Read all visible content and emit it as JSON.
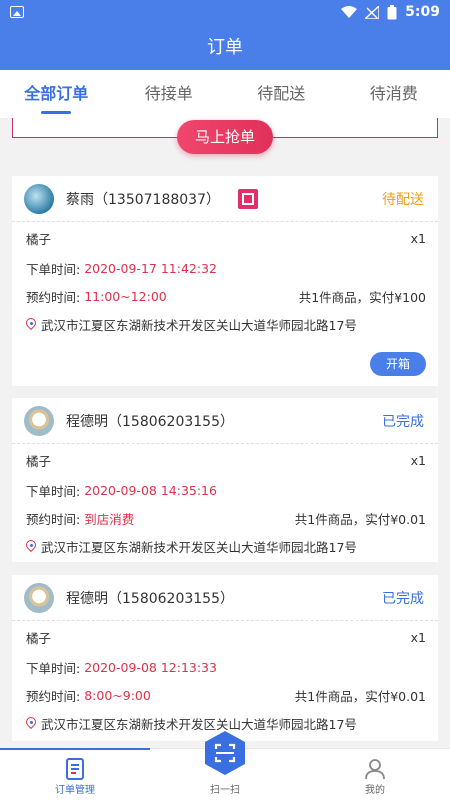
{
  "status_bar": {
    "time": "5:09"
  },
  "header": {
    "title": "订单"
  },
  "tabs": [
    {
      "label": "全部订单",
      "active": true
    },
    {
      "label": "待接单",
      "active": false
    },
    {
      "label": "待配送",
      "active": false
    },
    {
      "label": "待消费",
      "active": false
    }
  ],
  "grab_button": "马上抢单",
  "orders": [
    {
      "name": "蔡雨（13507188037）",
      "status": "待配送",
      "item": "橘子",
      "qty": "x1",
      "order_time_label": "下单时间:",
      "order_time": "2020-09-17 11:42:32",
      "reserve_label": "预约时间:",
      "reserve_time": "11:00~12:00",
      "summary": "共1件商品，实付¥100",
      "address": "武汉市江夏区东湖新技术开发区关山大道华师园北路17号",
      "action": "开箱"
    },
    {
      "name": "程德明（15806203155）",
      "status": "已完成",
      "item": "橘子",
      "qty": "x1",
      "order_time_label": "下单时间:",
      "order_time": "2020-09-08 14:35:16",
      "reserve_label": "预约时间:",
      "reserve_time": "到店消费",
      "summary": "共1件商品，实付¥0.01",
      "address": "武汉市江夏区东湖新技术开发区关山大道华师园北路17号"
    },
    {
      "name": "程德明（15806203155）",
      "status": "已完成",
      "item": "橘子",
      "qty": "x1",
      "order_time_label": "下单时间:",
      "order_time": "2020-09-08 12:13:33",
      "reserve_label": "预约时间:",
      "reserve_time": "8:00~9:00",
      "summary": "共1件商品，实付¥0.01",
      "address": "武汉市江夏区东湖新技术开发区关山大道华师园北路17号"
    }
  ],
  "bottom_nav": [
    {
      "label": "订单管理",
      "icon": "order-list-icon",
      "active": true
    },
    {
      "label": "扫一扫",
      "icon": "scan-icon",
      "active": false
    },
    {
      "label": "我的",
      "icon": "user-icon",
      "active": false
    }
  ],
  "colors": {
    "primary": "#4a7ee8",
    "accent_red": "#e0304a",
    "pending": "#f0a020"
  }
}
